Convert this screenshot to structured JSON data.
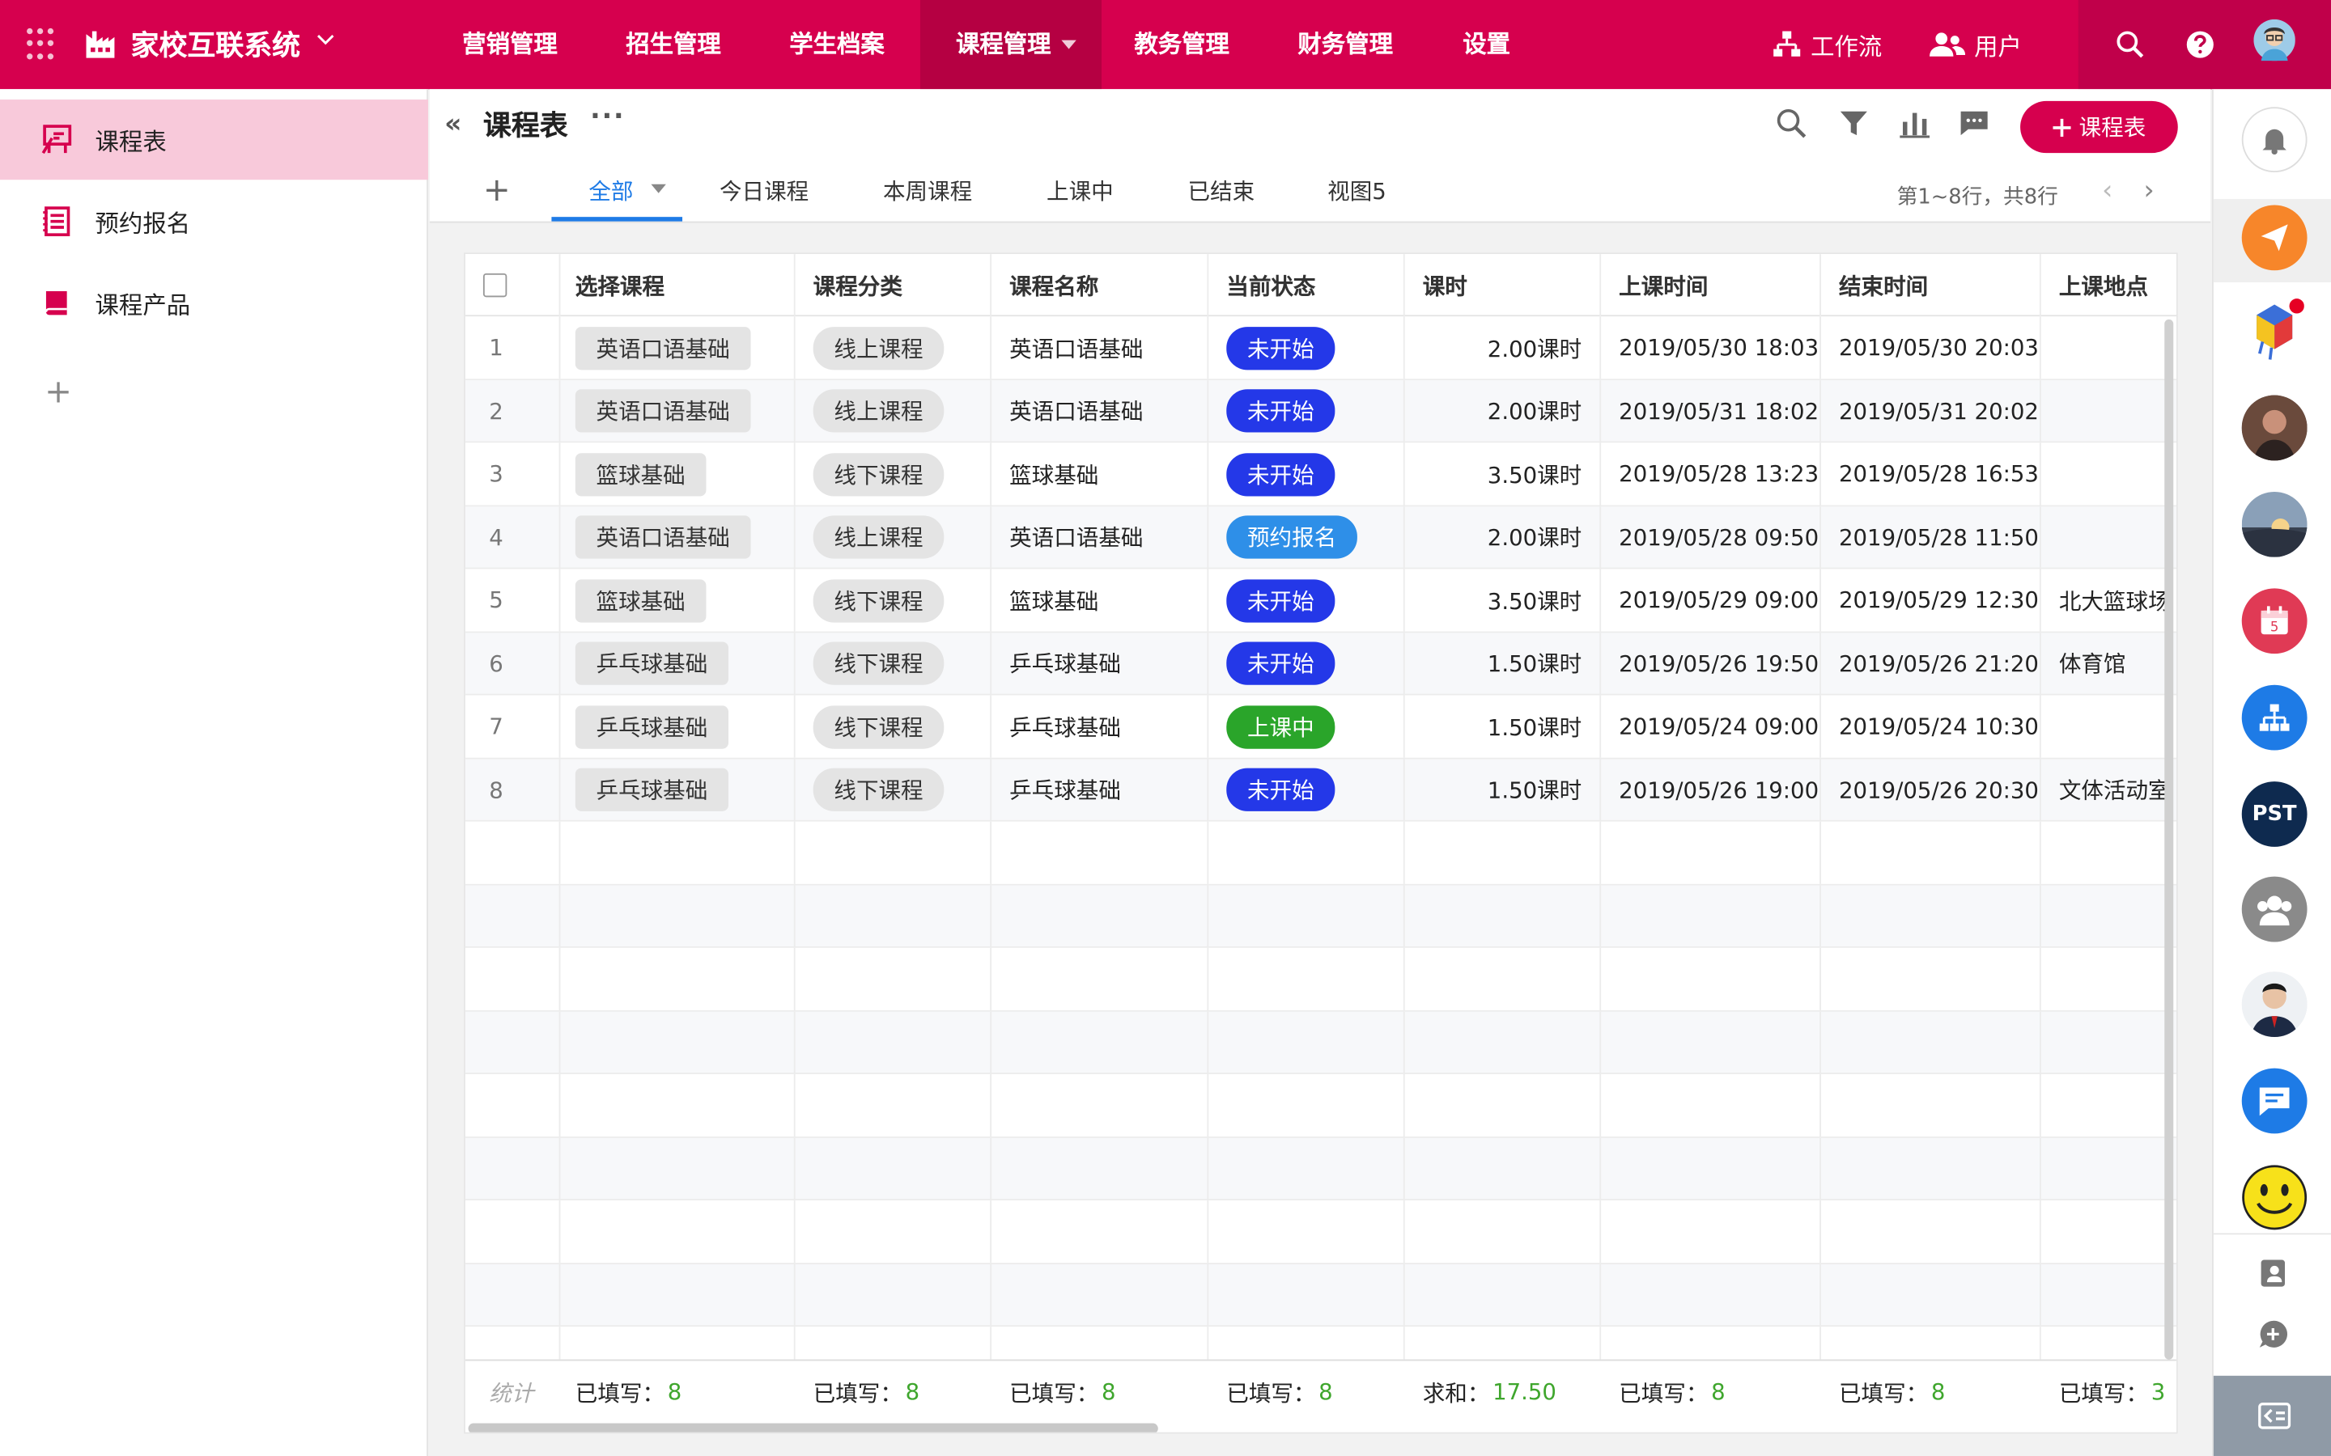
{
  "app": {
    "title": "家校互联系统"
  },
  "nav": [
    "营销管理",
    "招生管理",
    "学生档案",
    "课程管理",
    "教务管理",
    "财务管理",
    "设置"
  ],
  "topbar_right": {
    "workflow": "工作流",
    "user": "用户"
  },
  "sidebar": {
    "items": [
      "课程表",
      "预约报名",
      "课程产品"
    ],
    "add": "+"
  },
  "page": {
    "title": "课程表",
    "add_button": "课程表",
    "more": "···",
    "collapse": "«"
  },
  "tabs": {
    "add": "+",
    "items": [
      "全部",
      "今日课程",
      "本周课程",
      "上课中",
      "已结束",
      "视图5"
    ],
    "active": "全部"
  },
  "pager": {
    "text": "第1~8行，共8行",
    "prev": "‹",
    "next": "›"
  },
  "table": {
    "columns": [
      "选择课程",
      "课程分类",
      "课程名称",
      "当前状态",
      "课时",
      "上课时间",
      "结束时间",
      "上课地点"
    ],
    "rows": [
      {
        "n": "1",
        "course": "英语口语基础",
        "category": "线上课程",
        "name": "英语口语基础",
        "status": "未开始",
        "hours": "2.00课时",
        "start": "2019/05/30 18:03",
        "end": "2019/05/30 20:03",
        "location": ""
      },
      {
        "n": "2",
        "course": "英语口语基础",
        "category": "线上课程",
        "name": "英语口语基础",
        "status": "未开始",
        "hours": "2.00课时",
        "start": "2019/05/31 18:02",
        "end": "2019/05/31 20:02",
        "location": ""
      },
      {
        "n": "3",
        "course": "篮球基础",
        "category": "线下课程",
        "name": "篮球基础",
        "status": "未开始",
        "hours": "3.50课时",
        "start": "2019/05/28 13:23",
        "end": "2019/05/28 16:53",
        "location": ""
      },
      {
        "n": "4",
        "course": "英语口语基础",
        "category": "线上课程",
        "name": "英语口语基础",
        "status": "预约报名",
        "hours": "2.00课时",
        "start": "2019/05/28 09:50",
        "end": "2019/05/28 11:50",
        "location": ""
      },
      {
        "n": "5",
        "course": "篮球基础",
        "category": "线下课程",
        "name": "篮球基础",
        "status": "未开始",
        "hours": "3.50课时",
        "start": "2019/05/29 09:00",
        "end": "2019/05/29 12:30",
        "location": "北大篮球场"
      },
      {
        "n": "6",
        "course": "乒乓球基础",
        "category": "线下课程",
        "name": "乒乓球基础",
        "status": "未开始",
        "hours": "1.50课时",
        "start": "2019/05/26 19:50",
        "end": "2019/05/26 21:20",
        "location": "体育馆"
      },
      {
        "n": "7",
        "course": "乒乓球基础",
        "category": "线下课程",
        "name": "乒乓球基础",
        "status": "上课中",
        "hours": "1.50课时",
        "start": "2019/05/24 09:00",
        "end": "2019/05/24 10:30",
        "location": ""
      },
      {
        "n": "8",
        "course": "乒乓球基础",
        "category": "线下课程",
        "name": "乒乓球基础",
        "status": "未开始",
        "hours": "1.50课时",
        "start": "2019/05/26 19:00",
        "end": "2019/05/26 20:30",
        "location": "文体活动室"
      }
    ],
    "footer": {
      "label": "统计",
      "filled_label": "已填写：",
      "sum_label": "求和：",
      "values": [
        "8",
        "8",
        "8",
        "8",
        "17.50",
        "8",
        "8",
        "3"
      ]
    }
  },
  "status_colors": {
    "未开始": "#2438e8",
    "预约报名": "#2e8fe8",
    "上课中": "#2aa52a"
  },
  "rail": {
    "pst": "PST",
    "calendar_day": "5"
  },
  "colors": {
    "brand": "#d6004e",
    "accent": "#1e7be6"
  }
}
